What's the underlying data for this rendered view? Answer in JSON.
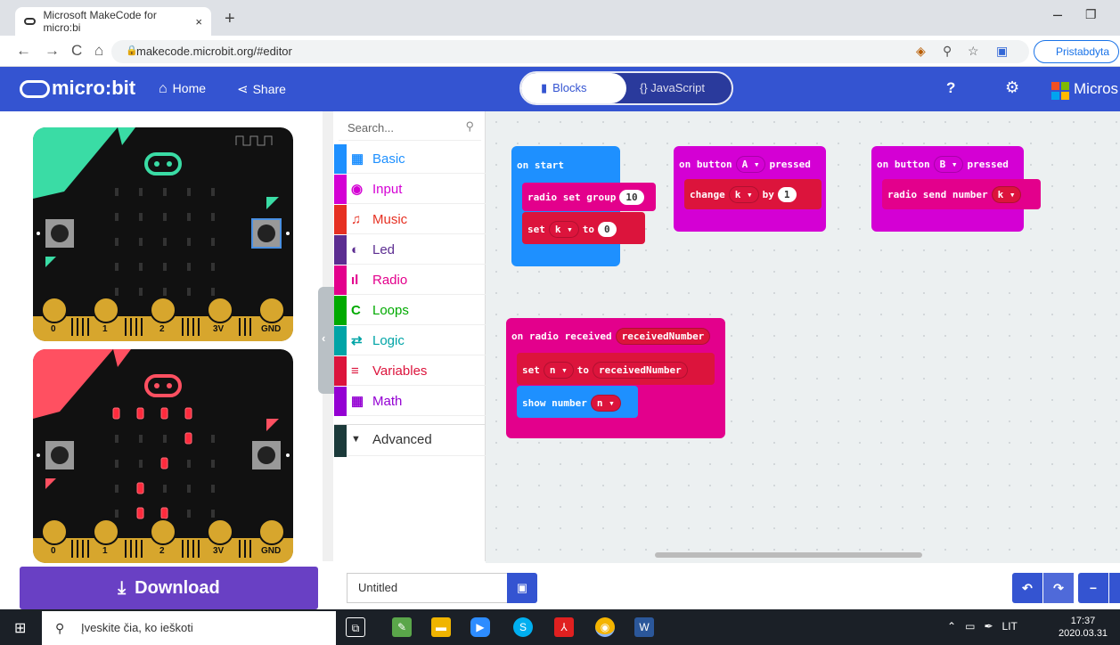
{
  "browser": {
    "tab_title": "Microsoft MakeCode for micro:bi",
    "tab_close": "×",
    "new_tab": "+",
    "nav_back": "←",
    "nav_forward": "→",
    "nav_reload": "C",
    "nav_home": "⌂",
    "lock": "🔒",
    "url": "makecode.microbit.org/#editor",
    "icons": [
      "translate-icon",
      "zoom-icon",
      "star-icon",
      "extension-icon"
    ],
    "profile_label": "Pristabdyta",
    "window_minimize": "–",
    "window_restore": "❐"
  },
  "header": {
    "logo_text": "micro:bit",
    "home_label": "Home",
    "share_label": "Share",
    "blocks_label": "Blocks",
    "js_label": "{} JavaScript",
    "help_icon": "?",
    "settings_icon": "⚙",
    "ms_label": "Micros"
  },
  "toolbox": {
    "search_placeholder": "Search...",
    "categories": [
      {
        "label": "Basic",
        "color": "#1e90ff",
        "icon": "▦"
      },
      {
        "label": "Input",
        "color": "#d400d4",
        "icon": "◉"
      },
      {
        "label": "Music",
        "color": "#e63022",
        "icon": "♫"
      },
      {
        "label": "Led",
        "color": "#5c2d91",
        "icon": "◐"
      },
      {
        "label": "Radio",
        "color": "#e3008c",
        "icon": "ıl"
      },
      {
        "label": "Loops",
        "color": "#00aa00",
        "icon": "C"
      },
      {
        "label": "Logic",
        "color": "#00a4a6",
        "icon": "⇄"
      },
      {
        "label": "Variables",
        "color": "#dc143c",
        "icon": "≡"
      },
      {
        "label": "Math",
        "color": "#9400d3",
        "icon": "▦"
      }
    ],
    "advanced_label": "Advanced",
    "advanced_icon": "▼"
  },
  "blocks": {
    "on_start": "on start",
    "radio_set_group": "radio set group",
    "group_value": "10",
    "set": "set",
    "k_var": "k ▾",
    "to": "to",
    "zero": "0",
    "on_button": "on button",
    "button_a": "A ▾",
    "pressed": "pressed",
    "change": "change",
    "by": "by",
    "one": "1",
    "button_b": "B ▾",
    "radio_send_number": "radio send number",
    "on_radio_received": "on radio received",
    "received_number": "receivedNumber",
    "n_var": "n ▾",
    "show_number": "show number"
  },
  "simulator": {
    "pin_labels": [
      "0",
      "1",
      "2",
      "3V",
      "GND"
    ],
    "button_a_label": "A",
    "button_b_label": "B"
  },
  "footer": {
    "download_label": "Download",
    "project_name": "Untitled",
    "save_icon": "💾",
    "undo_icon": "↶",
    "redo_icon": "↷",
    "zoom_out_icon": "−"
  },
  "taskbar": {
    "search_placeholder": "Įveskite čia, ko ieškoti",
    "lang": "LIT",
    "time": "17:37",
    "date": "2020.03.31"
  },
  "colors": {
    "accent": "#3454d1",
    "download": "#6940c4",
    "basic_block": "#1e90ff",
    "input_block": "#d400d4",
    "radio_block": "#e3008c",
    "variables_block": "#dc143c"
  }
}
